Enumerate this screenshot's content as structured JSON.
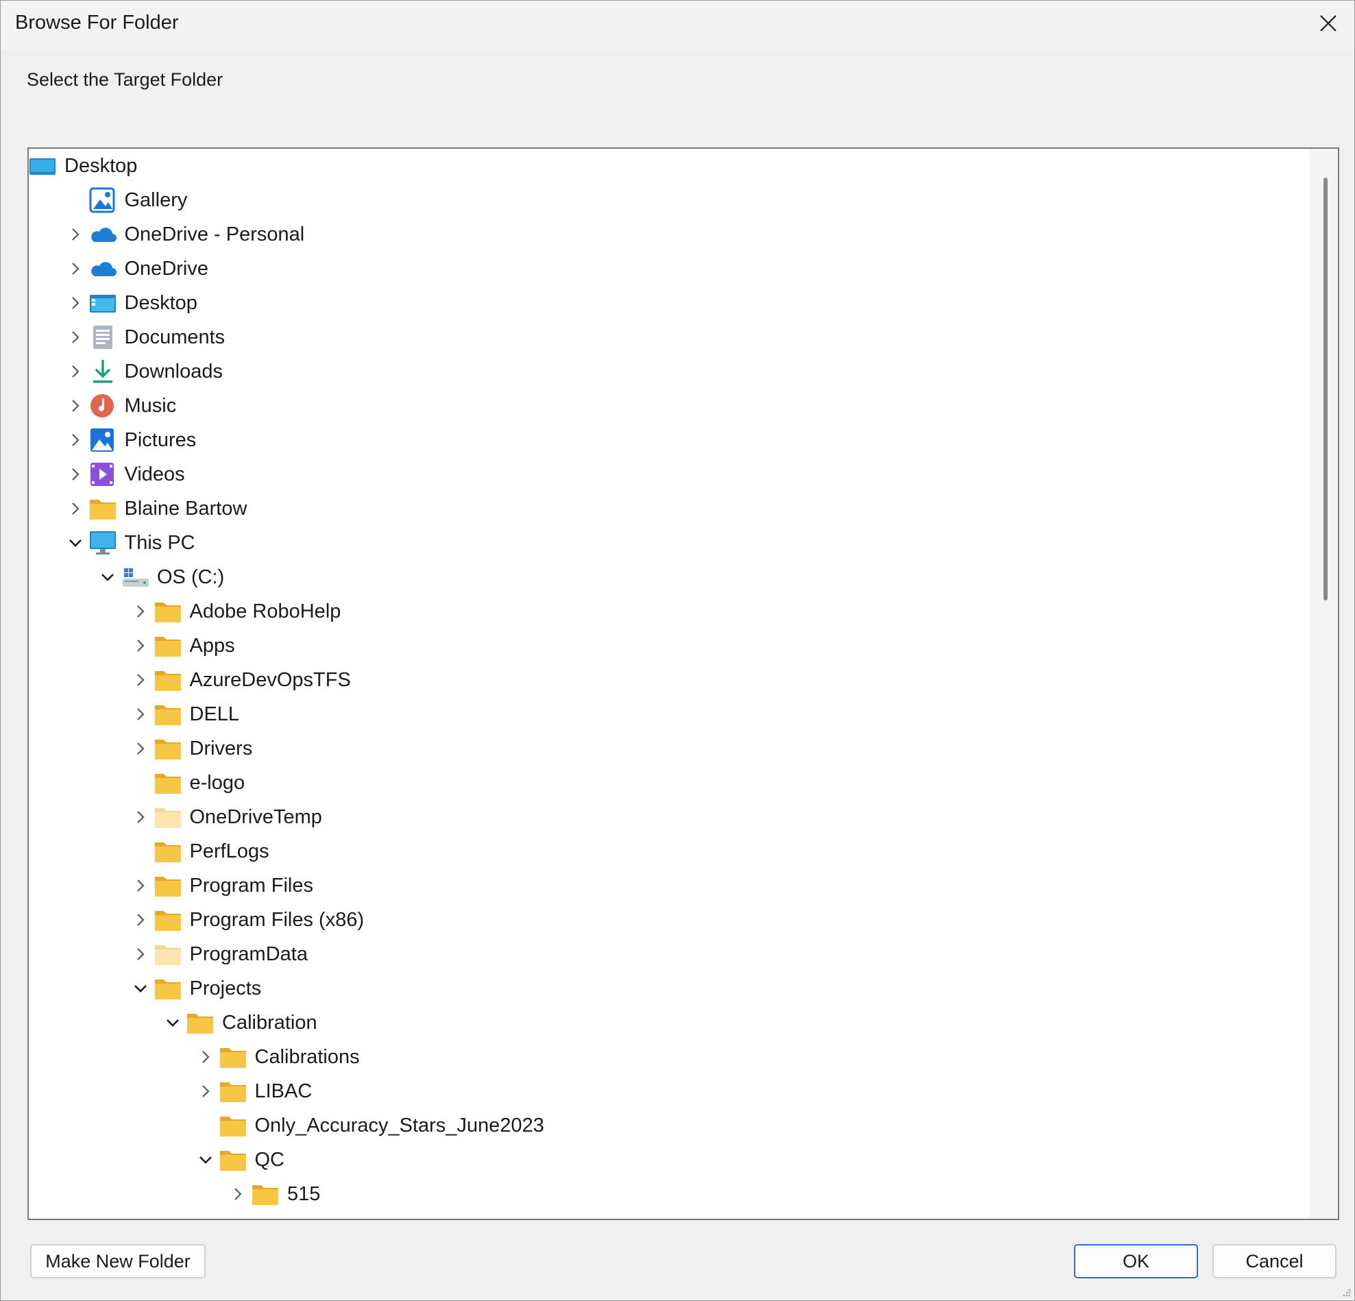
{
  "window": {
    "title": "Browse For Folder"
  },
  "instruction": "Select the Target Folder",
  "tree": [
    {
      "label": "Desktop",
      "icon": "desktop-icon",
      "level": 0,
      "expander": "none"
    },
    {
      "label": "Gallery",
      "icon": "gallery-icon",
      "level": 1,
      "expander": "none"
    },
    {
      "label": "OneDrive - Personal",
      "icon": "cloud-icon",
      "level": 1,
      "expander": "collapsed"
    },
    {
      "label": "OneDrive",
      "icon": "cloud-icon",
      "level": 1,
      "expander": "collapsed"
    },
    {
      "label": "Desktop",
      "icon": "desktop-folder-icon",
      "level": 1,
      "expander": "collapsed"
    },
    {
      "label": "Documents",
      "icon": "documents-icon",
      "level": 1,
      "expander": "collapsed"
    },
    {
      "label": "Downloads",
      "icon": "download-icon",
      "level": 1,
      "expander": "collapsed"
    },
    {
      "label": "Music",
      "icon": "music-icon",
      "level": 1,
      "expander": "collapsed"
    },
    {
      "label": "Pictures",
      "icon": "pictures-icon",
      "level": 1,
      "expander": "collapsed"
    },
    {
      "label": "Videos",
      "icon": "videos-icon",
      "level": 1,
      "expander": "collapsed"
    },
    {
      "label": "Blaine Bartow",
      "icon": "folder-icon",
      "level": 1,
      "expander": "collapsed"
    },
    {
      "label": "This PC",
      "icon": "monitor-icon",
      "level": 1,
      "expander": "expanded"
    },
    {
      "label": "OS (C:)",
      "icon": "drive-icon",
      "level": 2,
      "expander": "expanded"
    },
    {
      "label": "Adobe RoboHelp",
      "icon": "folder-icon",
      "level": 3,
      "expander": "collapsed"
    },
    {
      "label": "Apps",
      "icon": "folder-icon",
      "level": 3,
      "expander": "collapsed"
    },
    {
      "label": "AzureDevOpsTFS",
      "icon": "folder-icon",
      "level": 3,
      "expander": "collapsed"
    },
    {
      "label": "DELL",
      "icon": "folder-icon",
      "level": 3,
      "expander": "collapsed"
    },
    {
      "label": "Drivers",
      "icon": "folder-icon",
      "level": 3,
      "expander": "collapsed"
    },
    {
      "label": "e-logo",
      "icon": "folder-icon",
      "level": 3,
      "expander": "none"
    },
    {
      "label": "OneDriveTemp",
      "icon": "hidden-folder-icon",
      "level": 3,
      "expander": "collapsed"
    },
    {
      "label": "PerfLogs",
      "icon": "folder-icon",
      "level": 3,
      "expander": "none"
    },
    {
      "label": "Program Files",
      "icon": "folder-icon",
      "level": 3,
      "expander": "collapsed"
    },
    {
      "label": "Program Files (x86)",
      "icon": "folder-icon",
      "level": 3,
      "expander": "collapsed"
    },
    {
      "label": "ProgramData",
      "icon": "hidden-folder-icon",
      "level": 3,
      "expander": "collapsed"
    },
    {
      "label": "Projects",
      "icon": "folder-icon",
      "level": 3,
      "expander": "expanded"
    },
    {
      "label": "Calibration",
      "icon": "folder-icon",
      "level": 4,
      "expander": "expanded"
    },
    {
      "label": "Calibrations",
      "icon": "folder-icon",
      "level": 5,
      "expander": "collapsed"
    },
    {
      "label": "LIBAC",
      "icon": "folder-icon",
      "level": 5,
      "expander": "collapsed"
    },
    {
      "label": "Only_Accuracy_Stars_June2023",
      "icon": "folder-icon",
      "level": 5,
      "expander": "none"
    },
    {
      "label": "QC",
      "icon": "folder-icon",
      "level": 5,
      "expander": "expanded"
    },
    {
      "label": "515",
      "icon": "folder-icon",
      "level": 6,
      "expander": "collapsed"
    },
    {
      "label": "",
      "icon": "folder-icon",
      "level": 6,
      "expander": "none"
    }
  ],
  "buttons": {
    "make_new_folder": "Make New Folder",
    "ok": "OK",
    "cancel": "Cancel"
  },
  "colors": {
    "folder": "#f8c645",
    "folder_tab": "#e8a825",
    "hidden_folder": "#fbe6b0",
    "accent": "#2e6fd0"
  }
}
